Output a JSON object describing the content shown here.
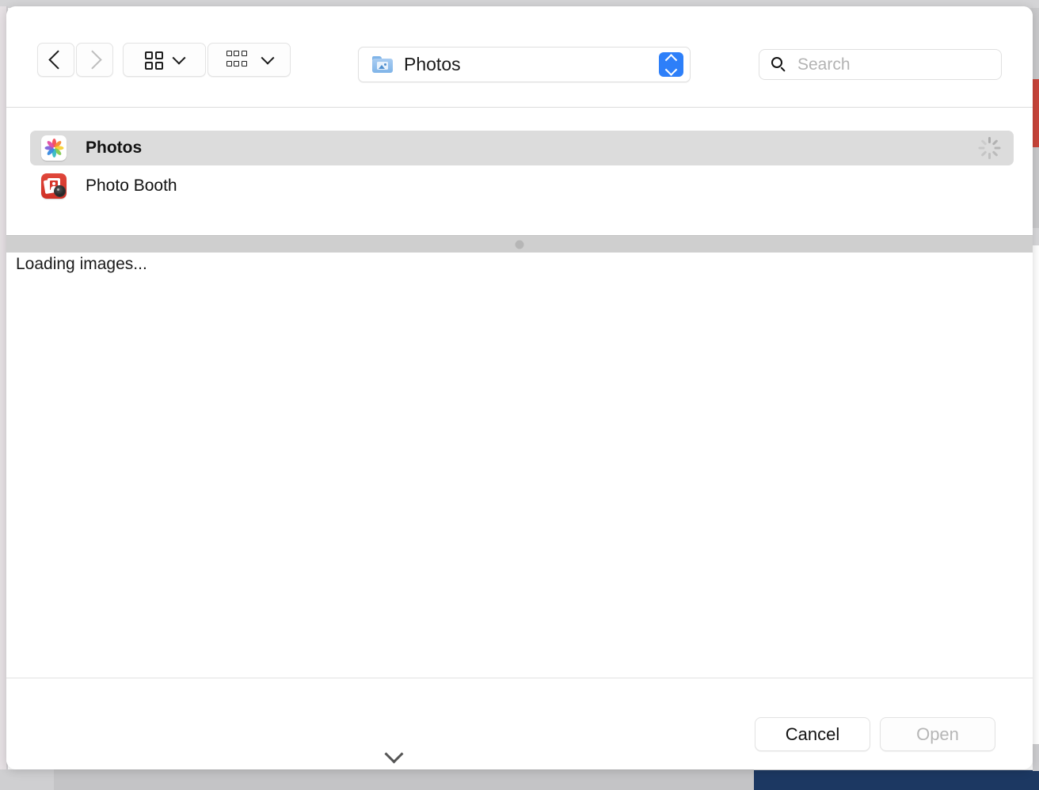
{
  "toolbar": {
    "back_icon": "chevron-left-icon",
    "forward_icon": "chevron-right-icon",
    "view_icon_label": "icon-view",
    "view_group_label": "group-view",
    "path": {
      "label": "Photos",
      "icon": "pictures-folder-icon",
      "stepper_icon": "up-down-stepper-icon"
    },
    "search": {
      "placeholder": "Search",
      "value": "",
      "icon": "search-icon"
    }
  },
  "results": {
    "items": [
      {
        "label": "Photos",
        "icon": "photos-app-icon",
        "selected": true,
        "busy": true
      },
      {
        "label": "Photo Booth",
        "icon": "photo-booth-app-icon",
        "selected": false,
        "busy": false
      }
    ]
  },
  "preview": {
    "status": "Loading images..."
  },
  "footer": {
    "cancel_label": "Cancel",
    "open_label": "Open",
    "open_disabled": true,
    "collapse_icon": "chevron-down-icon"
  },
  "colors": {
    "accent": "#2d7ff9",
    "selection": "#dcdcdc",
    "splitter": "#cfcfcf",
    "backdrop_red": "#c9453a",
    "backdrop_navy": "#1c3862",
    "disabled_text": "#b6b6b6"
  }
}
